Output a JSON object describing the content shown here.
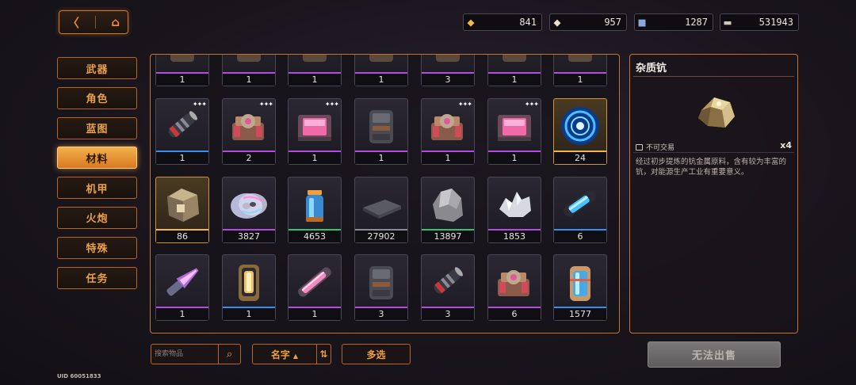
{
  "nav": {
    "back_glyph": "〈",
    "home_glyph": "⌂"
  },
  "currencies": [
    {
      "icon": "gold-crystal-icon",
      "glyph": "◆",
      "color": "#f0b84a",
      "value": "841"
    },
    {
      "icon": "silver-crystal-icon",
      "glyph": "◆",
      "color": "#e8e0c8",
      "value": "957"
    },
    {
      "icon": "blue-cube-icon",
      "glyph": "■",
      "color": "#8aa8d8",
      "value": "1287"
    },
    {
      "icon": "banknote-icon",
      "glyph": "▬",
      "color": "#cfc8b8",
      "value": "531943"
    }
  ],
  "categories": [
    "武器",
    "角色",
    "蓝图",
    "材料",
    "机甲",
    "火炮",
    "特殊",
    "任务"
  ],
  "active_category": "材料",
  "grid": {
    "rows": [
      [
        {
          "name": "partial-item",
          "count": "1",
          "rarity": "purple",
          "kind": "generic"
        },
        {
          "name": "partial-item",
          "count": "1",
          "rarity": "purple",
          "kind": "generic"
        },
        {
          "name": "partial-item",
          "count": "1",
          "rarity": "purple",
          "kind": "generic"
        },
        {
          "name": "partial-item",
          "count": "1",
          "rarity": "purple",
          "kind": "generic"
        },
        {
          "name": "partial-item",
          "count": "3",
          "rarity": "purple",
          "kind": "generic"
        },
        {
          "name": "partial-item",
          "count": "1",
          "rarity": "purple",
          "kind": "generic"
        },
        {
          "name": "partial-item",
          "count": "1",
          "rarity": "purple",
          "kind": "generic"
        }
      ],
      [
        {
          "name": "cylinder-core",
          "count": "1",
          "rarity": "blue",
          "kind": "cylinder",
          "stars": "✦✦✦"
        },
        {
          "name": "gear-module",
          "count": "2",
          "rarity": "purple",
          "kind": "gear",
          "stars": "✦✦✦"
        },
        {
          "name": "pink-chip",
          "count": "1",
          "rarity": "purple",
          "kind": "chip",
          "stars": "✦✦✦"
        },
        {
          "name": "armor-canister",
          "count": "1",
          "rarity": "purple",
          "kind": "canister"
        },
        {
          "name": "gear-module",
          "count": "1",
          "rarity": "purple",
          "kind": "gear",
          "stars": "✦✦✦"
        },
        {
          "name": "pink-chip",
          "count": "1",
          "rarity": "purple",
          "kind": "chip",
          "stars": "✦✦✦"
        },
        {
          "name": "blue-vortex",
          "count": "24",
          "rarity": "gold",
          "kind": "vortex"
        }
      ],
      [
        {
          "name": "ore-cube",
          "count": "86",
          "rarity": "gold",
          "kind": "orecube"
        },
        {
          "name": "data-disc",
          "count": "3827",
          "rarity": "purple",
          "kind": "disc"
        },
        {
          "name": "green-vial",
          "count": "4653",
          "rarity": "green",
          "kind": "vial"
        },
        {
          "name": "metal-plate",
          "count": "27902",
          "rarity": "grey",
          "kind": "plate"
        },
        {
          "name": "rock-ore",
          "count": "13897",
          "rarity": "green",
          "kind": "rock"
        },
        {
          "name": "crystal-shard",
          "count": "1853",
          "rarity": "purple",
          "kind": "crystal"
        },
        {
          "name": "blue-capsule",
          "count": "6",
          "rarity": "blue",
          "kind": "capsule"
        }
      ],
      [
        {
          "name": "plasma-blade",
          "count": "1",
          "rarity": "purple",
          "kind": "blade"
        },
        {
          "name": "gold-battery",
          "count": "1",
          "rarity": "blue",
          "kind": "battery"
        },
        {
          "name": "pink-rod",
          "count": "1",
          "rarity": "purple",
          "kind": "rod"
        },
        {
          "name": "armor-canister",
          "count": "3",
          "rarity": "purple",
          "kind": "canister"
        },
        {
          "name": "cylinder-core",
          "count": "3",
          "rarity": "purple",
          "kind": "cylinder"
        },
        {
          "name": "gear-module",
          "count": "6",
          "rarity": "purple",
          "kind": "gear"
        },
        {
          "name": "fuel-tank",
          "count": "1577",
          "rarity": "blue",
          "kind": "tank"
        }
      ]
    ]
  },
  "rarity_colors": {
    "purple": "#b44ae0",
    "blue": "#3a8ef0",
    "gold": "#f0b84a",
    "green": "#3ac06a",
    "grey": "#8a8a94"
  },
  "detail": {
    "name": "杂质钪",
    "trade_label": "不可交易",
    "quantity": "x4",
    "description": "经过初步提炼的钪金属原料，含有较为丰富的钪，对能源生产工业有重要意义。"
  },
  "bottom": {
    "search_placeholder": "搜索物品",
    "sort_label": "名字",
    "sort_dir_glyph": "▲",
    "flip_glyph": "⇅",
    "multi_select_label": "多选",
    "sell_label": "无法出售",
    "uid": "UID 60051833"
  }
}
